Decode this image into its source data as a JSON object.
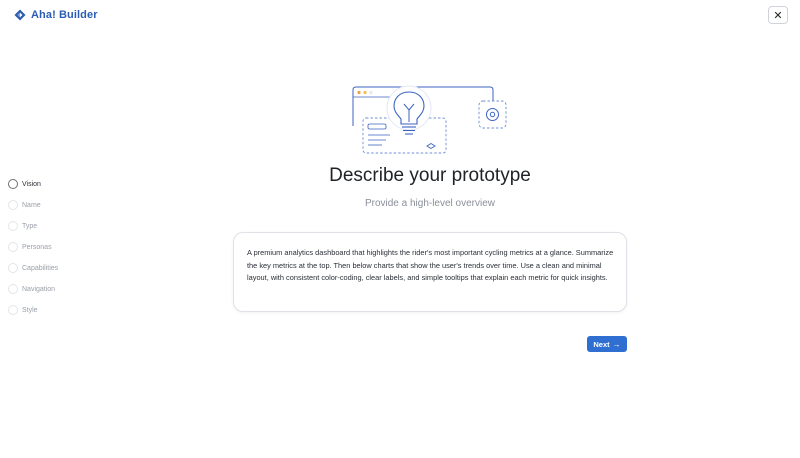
{
  "header": {
    "app_name": "Aha! Builder",
    "close_label": "✕"
  },
  "main": {
    "title": "Describe your prototype",
    "subtitle": "Provide a high-level overview",
    "description": "A premium analytics dashboard that highlights the rider's most important cycling metrics at a glance. Summarize the key metrics at the top. Then below charts that show the user's trends over time. Use a clean and minimal layout, with consistent color-coding, clear labels, and simple tooltips that explain each metric for quick insights.",
    "next_label": "Next",
    "next_arrow": "→"
  },
  "steps": [
    {
      "label": "Vision",
      "active": true
    },
    {
      "label": "Name",
      "active": false
    },
    {
      "label": "Type",
      "active": false
    },
    {
      "label": "Personas",
      "active": false
    },
    {
      "label": "Capabilities",
      "active": false
    },
    {
      "label": "Navigation",
      "active": false
    },
    {
      "label": "Style",
      "active": false
    }
  ],
  "colors": {
    "brand": "#2b5db3",
    "primary_button": "#2f6fd1",
    "illustration": "#3c63c2"
  },
  "icons": {
    "logo": "aha-logo-icon",
    "close": "close-icon",
    "illustration": "lightbulb-illustration",
    "next": "arrow-right-icon"
  }
}
